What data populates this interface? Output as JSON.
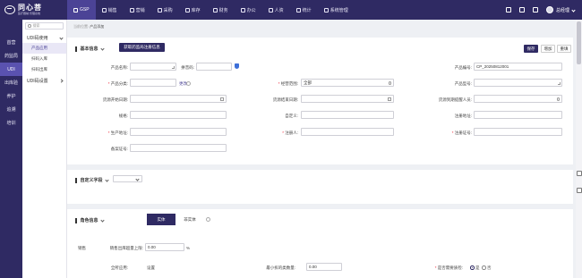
{
  "logo": {
    "title": "同心菩",
    "subtitle": "医疗器械·管理系统"
  },
  "topnav": [
    {
      "label": "GSP",
      "active": true,
      "icon": "gsp-icon"
    },
    {
      "label": "销售",
      "icon": "sales-icon"
    },
    {
      "label": "营销",
      "icon": "marketing-icon"
    },
    {
      "label": "采购",
      "icon": "purchase-icon"
    },
    {
      "label": "库存",
      "icon": "inventory-icon"
    },
    {
      "label": "财务",
      "icon": "finance-icon"
    },
    {
      "label": "办公",
      "icon": "office-icon"
    },
    {
      "label": "人资",
      "icon": "hr-icon"
    },
    {
      "label": "统计",
      "icon": "stats-icon"
    },
    {
      "label": "系统管理",
      "icon": "system-icon"
    }
  ],
  "user": {
    "name": "总经理"
  },
  "sidebar": [
    "首营",
    "药监局",
    "UDI",
    "出库验",
    "养护",
    "追溯",
    "培训"
  ],
  "sidebar_active": "UDI",
  "subnav": {
    "search_placeholder": "搜索",
    "group1": "UDI码使用",
    "items": [
      "产品应用",
      "扫码入库",
      "扫码出库"
    ],
    "active_item": "产品应用",
    "group2": "UDI码设置"
  },
  "breadcrumb": {
    "prefix": "当前位置:",
    "current": "产品添加"
  },
  "basic": {
    "title": "基本信息",
    "fetch_button": "获取药监局注册信息",
    "save": "保存",
    "add": "增加",
    "reset": "重填",
    "product_name_label": "产品名称:",
    "pinyin_label": "拼音码:",
    "product_code_label": "产品编号:",
    "product_code_value": "CP_20250812001",
    "category_label": "产品分类:",
    "change_link": "更改",
    "scope_label": "经营范围:",
    "scope_value": "全部",
    "model_label": "产品型号:",
    "supply_start_label": "货源开始日期:",
    "supply_end_label": "货源结束日期:",
    "supply_reminder_label": "货源到期提醒人员:",
    "spec_label": "规格:",
    "custom_label": "自定义:",
    "reg_address_label": "注册地址:",
    "producer_address_label": "生产地址:",
    "registrant_label": "注册人:",
    "reg_cert_label": "注册证号:",
    "filing_label": "备案证号:"
  },
  "custom_fields": {
    "title": "自定义字段"
  },
  "role": {
    "title": "角色信息",
    "tab_active": "实体",
    "tab_other": "非实体",
    "sales_label": "销售",
    "sales_ratio_label": "销售出库超量上限:",
    "sales_ratio_value": "0.00",
    "percent": "%",
    "scope_label": "全所应用:",
    "scope_value": "设置",
    "min_qty_label": "最小拆的类数量:",
    "min_qty_value": "0.00",
    "important_label": "是否需要质检:",
    "yes": "是",
    "no": "否"
  }
}
